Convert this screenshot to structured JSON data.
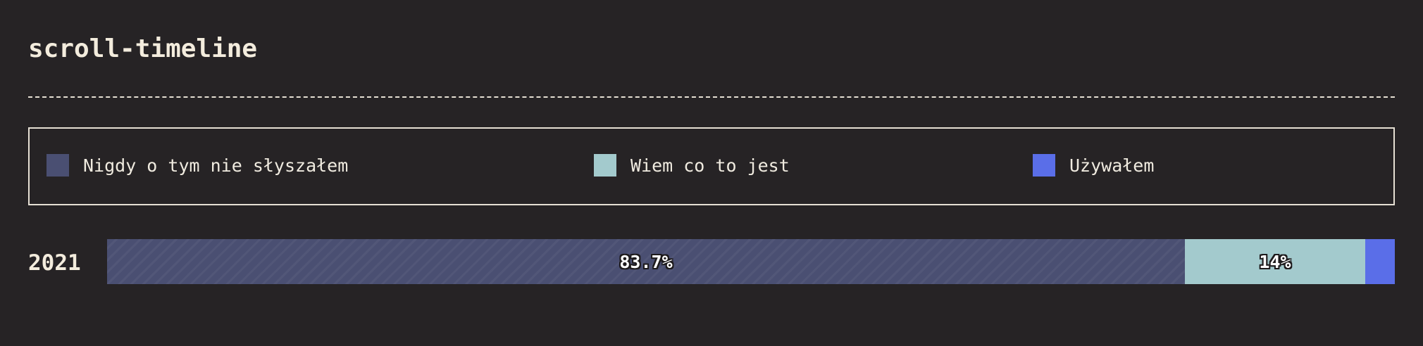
{
  "title": "scroll-timeline",
  "legend": [
    {
      "label": "Nigdy o tym nie słyszałem",
      "color": "#4a4f72"
    },
    {
      "label": "Wiem co to jest",
      "color": "#a3cacd"
    },
    {
      "label": "Używałem",
      "color": "#5a6ee8"
    }
  ],
  "chart_data": {
    "type": "bar",
    "orientation": "horizontal",
    "stacked": true,
    "normalized": true,
    "categories": [
      "2021"
    ],
    "series": [
      {
        "name": "Nigdy o tym nie słyszałem",
        "values": [
          83.7
        ],
        "label": "83.7%",
        "color": "#4a4f72"
      },
      {
        "name": "Wiem co to jest",
        "values": [
          14
        ],
        "label": "14%",
        "color": "#a3cacd"
      },
      {
        "name": "Używałem",
        "values": [
          2.3
        ],
        "label": "",
        "color": "#5a6ee8"
      }
    ],
    "unit": "%",
    "xlim": [
      0,
      100
    ]
  }
}
